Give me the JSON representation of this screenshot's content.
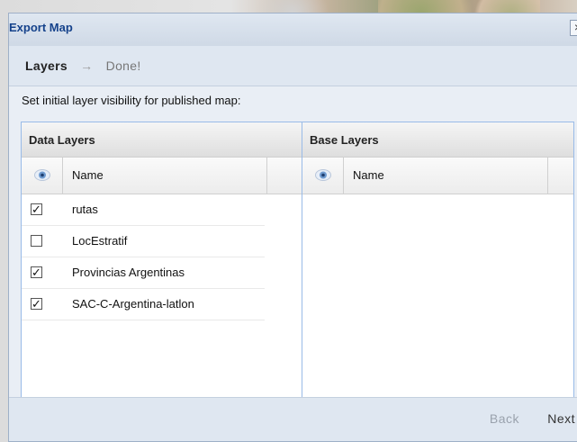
{
  "window": {
    "title": "Export Map",
    "close_label": "×"
  },
  "wizard": {
    "step_active": "Layers",
    "arrow": "→",
    "step_next": "Done!"
  },
  "instruction": "Set initial layer visibility for published map:",
  "data_layers": {
    "title": "Data Layers",
    "column_name": "Name",
    "rows": [
      {
        "label": "rutas",
        "checked": true
      },
      {
        "label": "LocEstratif",
        "checked": false
      },
      {
        "label": "Provincias Argentinas",
        "checked": true
      },
      {
        "label": "SAC-C-Argentina-latlon",
        "checked": true
      }
    ]
  },
  "base_layers": {
    "title": "Base Layers",
    "column_name": "Name",
    "rows": []
  },
  "footer": {
    "back_label": "Back",
    "next_label": "Next"
  },
  "icons": {
    "visibility": "eye-icon",
    "close": "close-icon",
    "checked": "✓"
  }
}
